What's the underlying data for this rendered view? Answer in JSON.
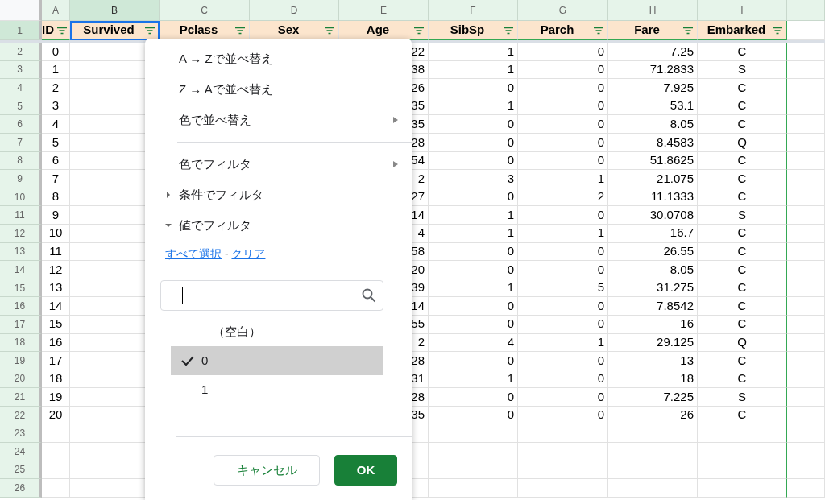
{
  "column_letters": [
    {
      "letter": "A",
      "selected": false
    },
    {
      "letter": "B",
      "selected": true
    },
    {
      "letter": "C",
      "selected": false
    },
    {
      "letter": "D",
      "selected": false
    },
    {
      "letter": "E",
      "selected": false
    },
    {
      "letter": "F",
      "selected": false
    },
    {
      "letter": "G",
      "selected": false
    },
    {
      "letter": "H",
      "selected": false
    },
    {
      "letter": "I",
      "selected": false
    }
  ],
  "header_row": {
    "number": "1",
    "cells": [
      {
        "text": "ID",
        "selected": false
      },
      {
        "text": "Survived",
        "selected": true
      },
      {
        "text": "Pclass",
        "selected": false
      },
      {
        "text": "Sex",
        "selected": false
      },
      {
        "text": "Age",
        "selected": false
      },
      {
        "text": "SibSp",
        "selected": false
      },
      {
        "text": "Parch",
        "selected": false
      },
      {
        "text": "Fare",
        "selected": false
      },
      {
        "text": "Embarked",
        "selected": false
      }
    ]
  },
  "rows": [
    {
      "number": "2",
      "id": "0",
      "age": "22",
      "sibsp": "1",
      "parch": "0",
      "fare": "7.25",
      "embarked": "C"
    },
    {
      "number": "3",
      "id": "1",
      "age": "38",
      "sibsp": "1",
      "parch": "0",
      "fare": "71.2833",
      "embarked": "S"
    },
    {
      "number": "4",
      "id": "2",
      "age": "26",
      "sibsp": "0",
      "parch": "0",
      "fare": "7.925",
      "embarked": "C"
    },
    {
      "number": "5",
      "id": "3",
      "age": "35",
      "sibsp": "1",
      "parch": "0",
      "fare": "53.1",
      "embarked": "C"
    },
    {
      "number": "6",
      "id": "4",
      "age": "35",
      "sibsp": "0",
      "parch": "0",
      "fare": "8.05",
      "embarked": "C"
    },
    {
      "number": "7",
      "id": "5",
      "age": "28",
      "sibsp": "0",
      "parch": "0",
      "fare": "8.4583",
      "embarked": "Q"
    },
    {
      "number": "8",
      "id": "6",
      "age": "54",
      "sibsp": "0",
      "parch": "0",
      "fare": "51.8625",
      "embarked": "C"
    },
    {
      "number": "9",
      "id": "7",
      "age": "2",
      "sibsp": "3",
      "parch": "1",
      "fare": "21.075",
      "embarked": "C"
    },
    {
      "number": "10",
      "id": "8",
      "age": "27",
      "sibsp": "0",
      "parch": "2",
      "fare": "11.1333",
      "embarked": "C"
    },
    {
      "number": "11",
      "id": "9",
      "age": "14",
      "sibsp": "1",
      "parch": "0",
      "fare": "30.0708",
      "embarked": "S"
    },
    {
      "number": "12",
      "id": "10",
      "age": "4",
      "sibsp": "1",
      "parch": "1",
      "fare": "16.7",
      "embarked": "C"
    },
    {
      "number": "13",
      "id": "11",
      "age": "58",
      "sibsp": "0",
      "parch": "0",
      "fare": "26.55",
      "embarked": "C"
    },
    {
      "number": "14",
      "id": "12",
      "age": "20",
      "sibsp": "0",
      "parch": "0",
      "fare": "8.05",
      "embarked": "C"
    },
    {
      "number": "15",
      "id": "13",
      "age": "39",
      "sibsp": "1",
      "parch": "5",
      "fare": "31.275",
      "embarked": "C"
    },
    {
      "number": "16",
      "id": "14",
      "age": "14",
      "sibsp": "0",
      "parch": "0",
      "fare": "7.8542",
      "embarked": "C"
    },
    {
      "number": "17",
      "id": "15",
      "age": "55",
      "sibsp": "0",
      "parch": "0",
      "fare": "16",
      "embarked": "C"
    },
    {
      "number": "18",
      "id": "16",
      "age": "2",
      "sibsp": "4",
      "parch": "1",
      "fare": "29.125",
      "embarked": "Q"
    },
    {
      "number": "19",
      "id": "17",
      "age": "28",
      "sibsp": "0",
      "parch": "0",
      "fare": "13",
      "embarked": "C"
    },
    {
      "number": "20",
      "id": "18",
      "age": "31",
      "sibsp": "1",
      "parch": "0",
      "fare": "18",
      "embarked": "C"
    },
    {
      "number": "21",
      "id": "19",
      "age": "28",
      "sibsp": "0",
      "parch": "0",
      "fare": "7.225",
      "embarked": "S"
    },
    {
      "number": "22",
      "id": "20",
      "age": "35",
      "sibsp": "0",
      "parch": "0",
      "fare": "26",
      "embarked": "C"
    }
  ],
  "blank_rows": [
    "23",
    "24",
    "25",
    "26"
  ],
  "filter_menu": {
    "items": [
      {
        "kind": "action",
        "label": "A → Zで並べ替え"
      },
      {
        "kind": "action",
        "label": "Z → Aで並べ替え"
      },
      {
        "kind": "submenu",
        "label": "色で並べ替え"
      },
      {
        "kind": "divider"
      },
      {
        "kind": "submenu",
        "label": "色でフィルタ"
      },
      {
        "kind": "section",
        "label": "条件でフィルタ",
        "expanded": false
      },
      {
        "kind": "section",
        "label": "値でフィルタ",
        "expanded": true
      }
    ],
    "links": [
      "すべて選択",
      "クリア"
    ],
    "link_separator": "-",
    "values": [
      {
        "label": "（空白）",
        "checked": false,
        "selected": false
      },
      {
        "label": "0",
        "checked": true,
        "selected": true
      },
      {
        "label": "1",
        "checked": false,
        "selected": false
      }
    ],
    "buttons": [
      {
        "label": "キャンセル",
        "kind": "secondary"
      },
      {
        "label": "OK",
        "kind": "primary"
      }
    ]
  }
}
